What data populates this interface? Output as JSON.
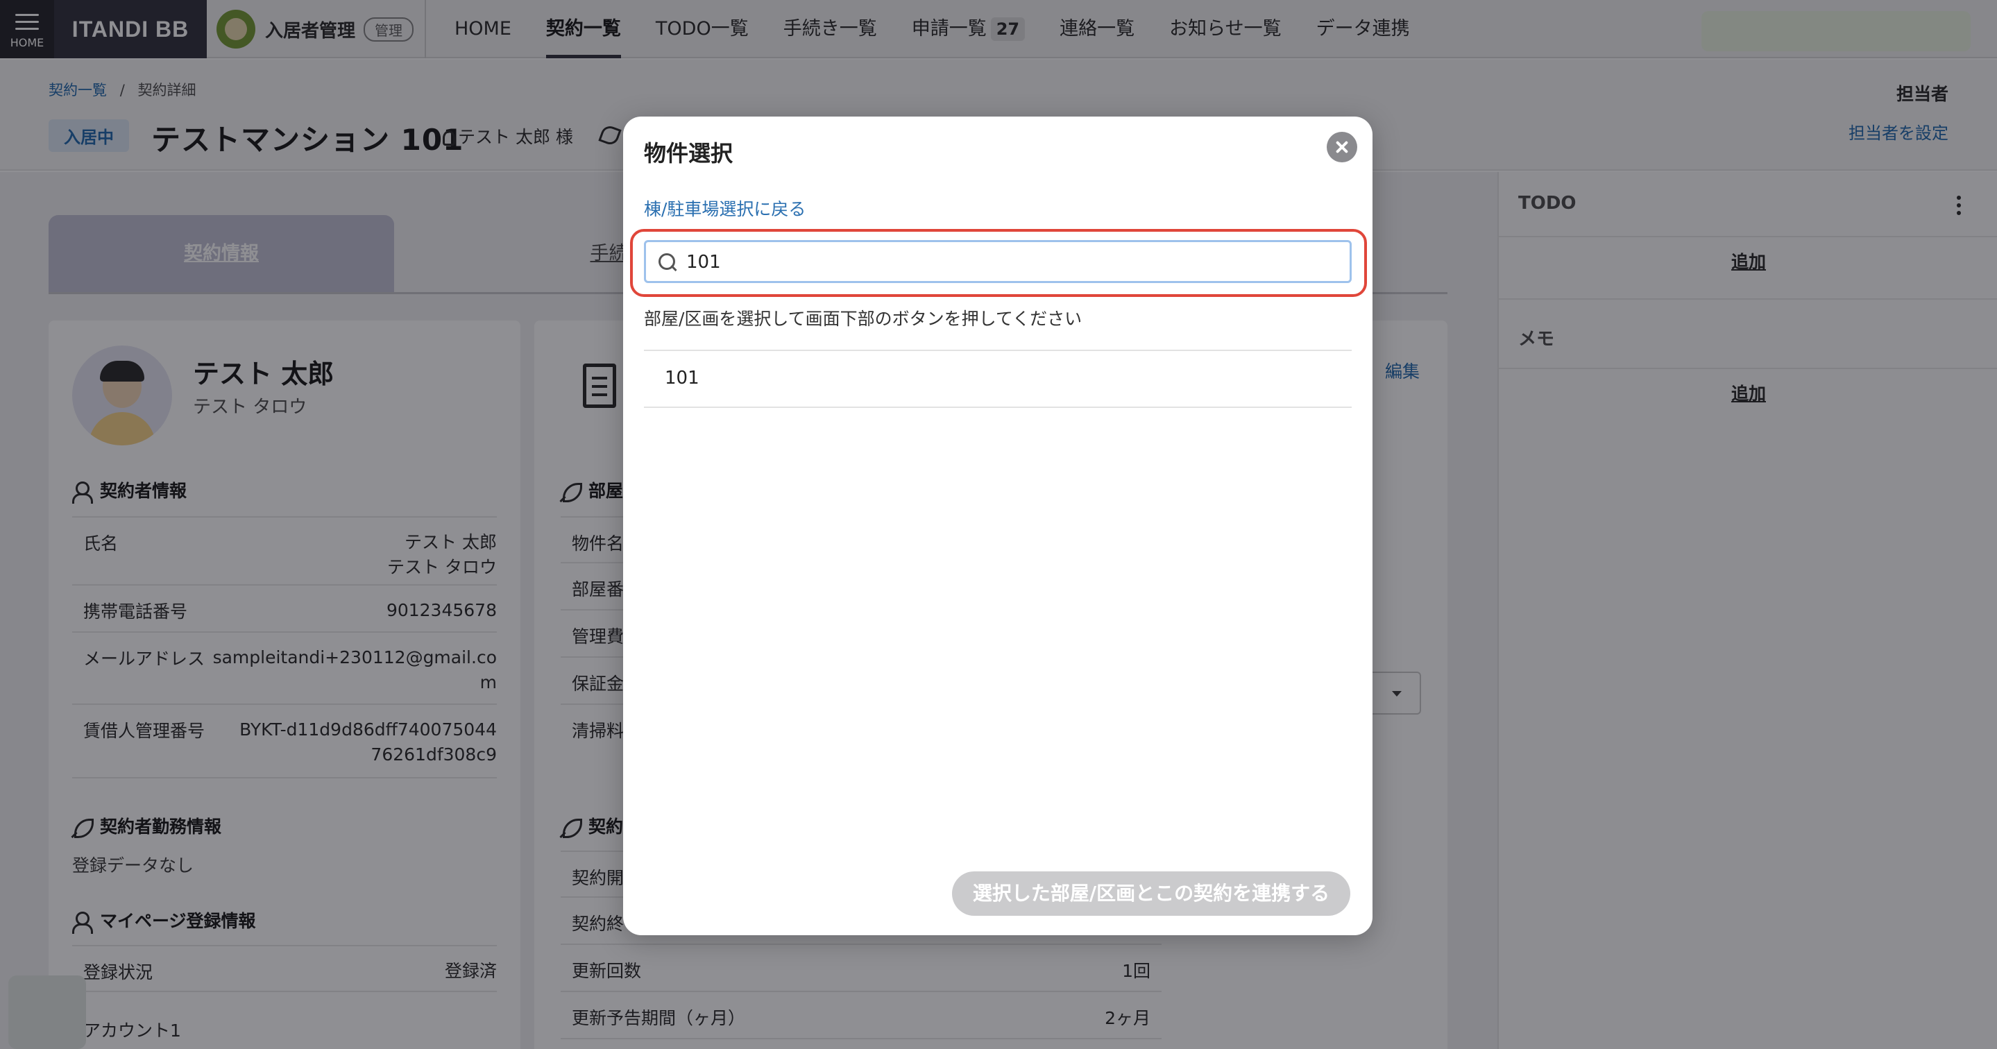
{
  "nav": {
    "home_label": "HOME",
    "brand": "ITANDI BB",
    "app_name": "入居者管理",
    "app_badge": "管理",
    "items": [
      {
        "label": "HOME"
      },
      {
        "label": "契約一覧",
        "active": true
      },
      {
        "label": "TODO一覧"
      },
      {
        "label": "手続き一覧"
      },
      {
        "label": "申請一覧",
        "count": "27"
      },
      {
        "label": "連絡一覧"
      },
      {
        "label": "お知らせ一覧"
      },
      {
        "label": "データ連携"
      }
    ]
  },
  "header": {
    "breadcrumb": [
      "契約一覧",
      "契約詳細"
    ],
    "breadcrumb_sep": "/",
    "status": "入居中",
    "title": "テストマンション 101",
    "tenant": "テスト 太郎 様",
    "assignee_label": "担当者",
    "assignee_action": "担当者を設定"
  },
  "tabs": [
    "契約情報",
    "手続き"
  ],
  "contractor": {
    "name": "テスト 太郎",
    "kana": "テスト タロウ",
    "section_title": "契約者情報",
    "rows": [
      {
        "label": "氏名",
        "value_lines": [
          "テスト 太郎",
          "テスト タロウ"
        ]
      },
      {
        "label": "携帯電話番号",
        "value_lines": [
          "9012345678"
        ]
      },
      {
        "label": "メールアドレス",
        "value_lines": [
          "sampleitandi+230112@gmail.co",
          "m"
        ]
      },
      {
        "label": "賃借人管理番号",
        "value_lines": [
          "BYKT-d11d9d86dff740075044",
          "76261df308c9"
        ]
      }
    ],
    "work_title": "契約者勤務情報",
    "work_empty": "登録データなし",
    "mypage_title": "マイページ登録情報",
    "mypage_rows": [
      {
        "label": "登録状況",
        "value": "登録済"
      },
      {
        "label": "アカウント1",
        "value": ""
      }
    ]
  },
  "property_card": {
    "edit": "編集",
    "section1_title_partial": "部屋",
    "rows_partial": [
      "物件名",
      "部屋番",
      "管理費",
      "保証金",
      "清掃料"
    ],
    "section2_title_partial": "契約",
    "rows2_partial": [
      "契約開",
      "契約終"
    ],
    "rows2": [
      {
        "label": "更新回数",
        "value": "1回"
      },
      {
        "label": "更新予告期間（ヶ月）",
        "value": "2ヶ月"
      }
    ]
  },
  "sidebar": {
    "todo_title": "TODO",
    "todo_add": "追加",
    "memo_title": "メモ",
    "memo_add": "追加"
  },
  "modal": {
    "title": "物件選択",
    "back_link": "棟/駐車場選択に戻る",
    "search_value": "101",
    "hint": "部屋/区画を選択して画面下部のボタンを押してください",
    "results": [
      "101"
    ],
    "confirm_button": "選択した部屋/区画とこの契約を連携する"
  }
}
